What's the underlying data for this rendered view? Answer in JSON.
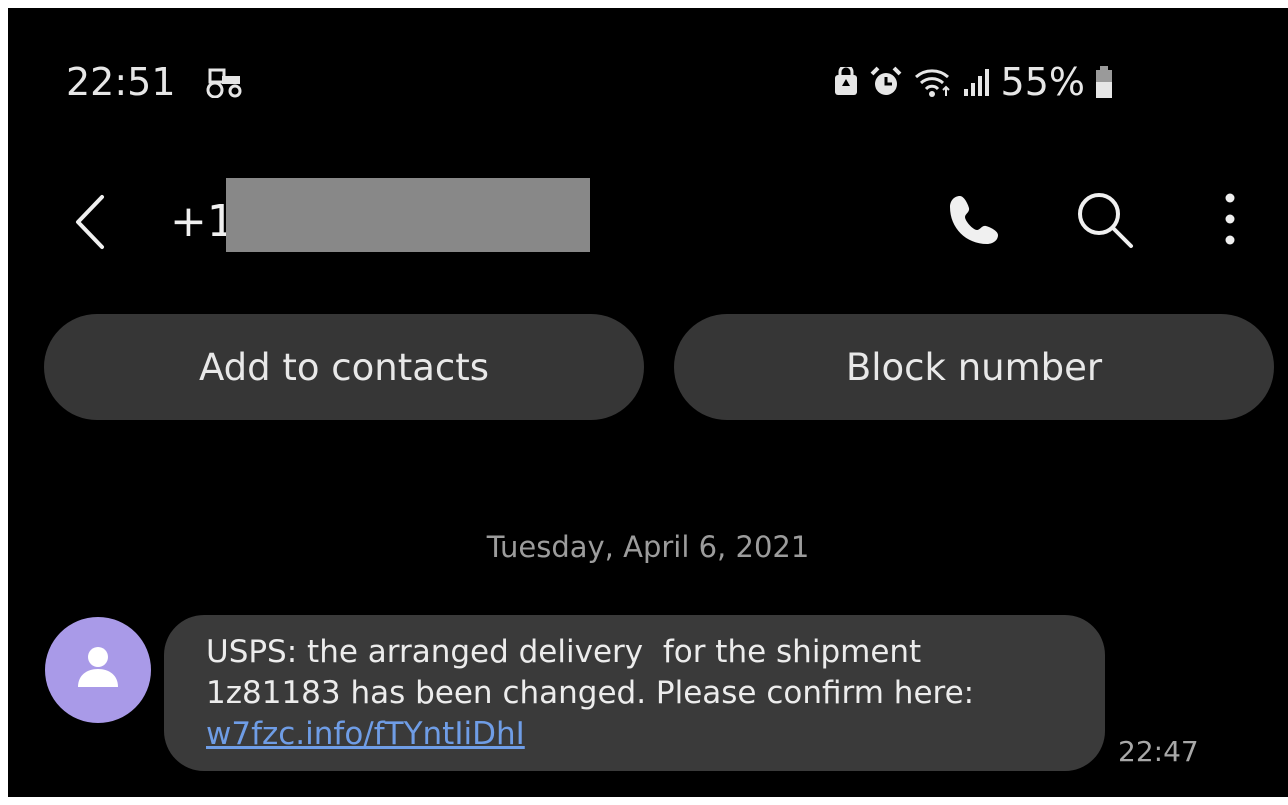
{
  "status_bar": {
    "time": "22:51",
    "battery": "55%",
    "icons": [
      "tractor-icon",
      "recycle-lock-icon",
      "alarm-icon",
      "wifi-icon",
      "signal-icon",
      "battery-icon"
    ]
  },
  "header": {
    "contact_prefix": "+1",
    "icons": [
      "back-icon",
      "phone-icon",
      "search-icon",
      "more-icon"
    ]
  },
  "actions": {
    "add_contact": "Add to contacts",
    "block_number": "Block number"
  },
  "conversation": {
    "date": "Tuesday, April 6, 2021",
    "messages": [
      {
        "line1": "USPS: the arranged delivery  for the shipment",
        "line2": "1z81183 has been changed. Please confirm here:",
        "link": "w7fzc.info/fTYntIiDhI",
        "time": "22:47"
      }
    ]
  },
  "colors": {
    "background": "#000000",
    "pill": "#363636",
    "bubble": "#3a3a3a",
    "avatar": "#a99ae8",
    "link": "#6f9de6"
  }
}
